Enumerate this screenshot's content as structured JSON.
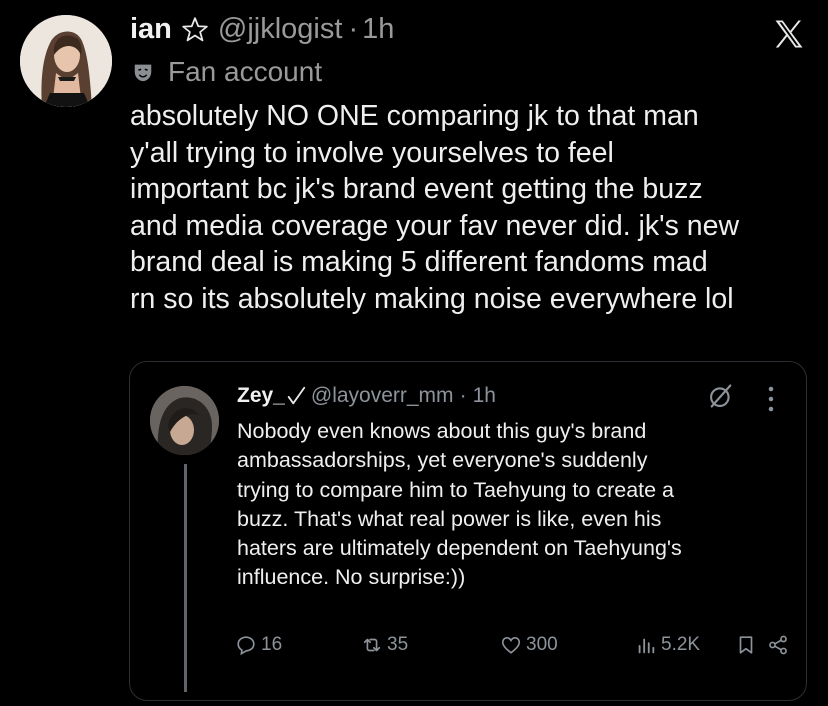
{
  "tweet": {
    "display_name": "ian",
    "handle": "@jjklogist",
    "separator": "·",
    "time": "1h",
    "label": "Fan account",
    "lines": [
      "absolutely NO ONE comparing jk to that man",
      "y'all trying to involve yourselves to feel",
      "important bc jk's brand event getting the buzz",
      "and media coverage your fav never did. jk's new",
      "brand deal is making 5 different fandoms mad",
      "rn so its absolutely making noise everywhere lol"
    ]
  },
  "quoted": {
    "display_name": "Zey_",
    "handle": "@layoverr_mm",
    "separator": "·",
    "time": "1h",
    "lines": [
      "Nobody even knows about this guy's brand",
      "ambassadorships, yet everyone's suddenly",
      "trying to compare him to Taehyung to create a",
      "buzz. That's what real power is like, even his",
      "haters are ultimately dependent on Taehyung's",
      "influence. No surprise:))"
    ],
    "stats": {
      "replies": "16",
      "reposts": "35",
      "likes": "300",
      "views": "5.2K"
    }
  },
  "icons": [
    "x-logo-icon",
    "star-icon",
    "mask-icon",
    "verified-check-icon",
    "grok-icon",
    "more-icon",
    "reply-icon",
    "repost-icon",
    "like-icon",
    "views-icon",
    "bookmark-icon",
    "share-icon"
  ],
  "colors": {
    "background": "#000000",
    "text": "#e7e9ea",
    "muted": "#9a9a9a",
    "border": "#2b2f33"
  }
}
